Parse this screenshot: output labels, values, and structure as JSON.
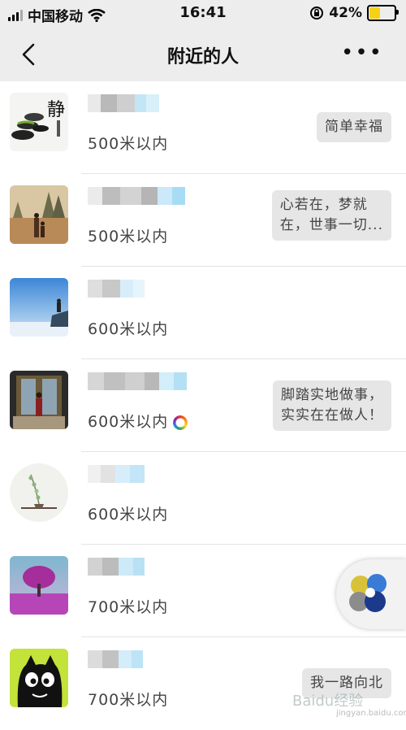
{
  "status_bar": {
    "carrier": "中国移动",
    "time": "16:41",
    "battery": "42%",
    "battery_level": 0.42
  },
  "nav": {
    "title": "附近的人",
    "more_label": "•••"
  },
  "rows": [
    {
      "distance": "500米以内",
      "signature": "简单幸福"
    },
    {
      "distance": "500米以内",
      "signature": "心若在，梦就\n在，世事一切..."
    },
    {
      "distance": "600米以内",
      "signature": ""
    },
    {
      "distance": "600米以内",
      "signature": "脚踏实地做事，\n实实在在做人！"
    },
    {
      "distance": "600米以内",
      "signature": ""
    },
    {
      "distance": "700米以内",
      "signature": ""
    },
    {
      "distance": "700米以内",
      "signature": "我一路向北"
    }
  ],
  "watermark": {
    "text": "Baidu经验",
    "sub": "jingyan.baidu.com"
  }
}
